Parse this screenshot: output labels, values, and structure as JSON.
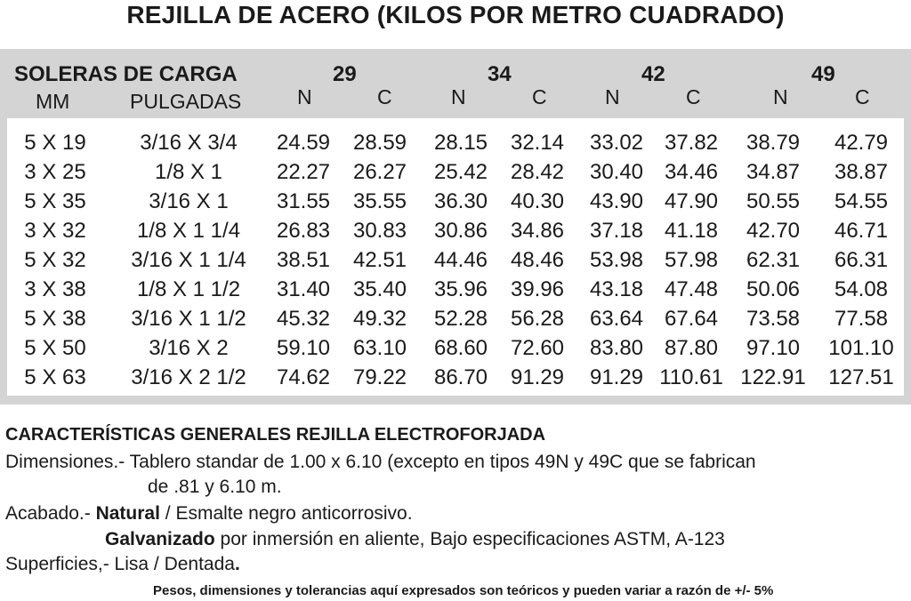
{
  "title": "REJILLA DE ACERO (KILOS POR METRO CUADRADO)",
  "table": {
    "soleras_label": "SOLERAS DE CARGA",
    "mm_label": "MM",
    "pulgadas_label": "PULGADAS",
    "groups": [
      "29",
      "34",
      "42",
      "49"
    ],
    "n_label": "N",
    "c_label": "C",
    "rows": [
      {
        "mm": "5 X 19",
        "pulg": "3/16 X 3/4",
        "vals": [
          "24.59",
          "28.59",
          "28.15",
          "32.14",
          "33.02",
          "37.82",
          "38.79",
          "42.79"
        ]
      },
      {
        "mm": "3 X 25",
        "pulg": "1/8 X 1",
        "vals": [
          "22.27",
          "26.27",
          "25.42",
          "28.42",
          "30.40",
          "34.46",
          "34.87",
          "38.87"
        ]
      },
      {
        "mm": "5 X 35",
        "pulg": "3/16 X 1",
        "vals": [
          "31.55",
          "35.55",
          "36.30",
          "40.30",
          "43.90",
          "47.90",
          "50.55",
          "54.55"
        ]
      },
      {
        "mm": "3 X 32",
        "pulg": "1/8 X 1 1/4",
        "vals": [
          "26.83",
          "30.83",
          "30.86",
          "34.86",
          "37.18",
          "41.18",
          "42.70",
          "46.71"
        ]
      },
      {
        "mm": "5 X 32",
        "pulg": "3/16 X 1 1/4",
        "vals": [
          "38.51",
          "42.51",
          "44.46",
          "48.46",
          "53.98",
          "57.98",
          "62.31",
          "66.31"
        ]
      },
      {
        "mm": "3 X 38",
        "pulg": "1/8 X 1 1/2",
        "vals": [
          "31.40",
          "35.40",
          "35.96",
          "39.96",
          "43.18",
          "47.48",
          "50.06",
          "54.08"
        ]
      },
      {
        "mm": "5 X 38",
        "pulg": "3/16 X 1 1/2",
        "vals": [
          "45.32",
          "49.32",
          "52.28",
          "56.28",
          "63.64",
          "67.64",
          "73.58",
          "77.58"
        ]
      },
      {
        "mm": "5 X 50",
        "pulg": "3/16 X 2",
        "vals": [
          "59.10",
          "63.10",
          "68.60",
          "72.60",
          "83.80",
          "87.80",
          "97.10",
          "101.10"
        ]
      },
      {
        "mm": "5 X 63",
        "pulg": "3/16 X 2 1/2",
        "vals": [
          "74.62",
          "79.22",
          "86.70",
          "91.29",
          "91.29",
          "110.61",
          "122.91",
          "127.51"
        ]
      }
    ]
  },
  "notes": {
    "heading": "CARACTERÍSTICAS GENERALES REJILLA ELECTROFORJADA",
    "dimensiones_1": "Dimensiones.- Tablero standar de 1.00 x 6.10 (excepto en tipos 49N y 49C que se fabrican",
    "dimensiones_2": "de .81 y 6.10 m.",
    "acabado_prefix": "Acabado.- ",
    "acabado_natural": "Natural",
    "acabado_rest": " / Esmalte negro anticorrosivo.",
    "galvanizado_bold": "Galvanizado",
    "galvanizado_rest": " por inmersión en aliente, Bajo especificaciones ASTM, A-123",
    "superficies_prefix": "Superficies,- Lisa / Dentada",
    "superficies_dot": ".",
    "footnote": "Pesos, dimensiones y tolerancias aquí expresados son teóricos y pueden variar a razón de +/- 5%"
  }
}
